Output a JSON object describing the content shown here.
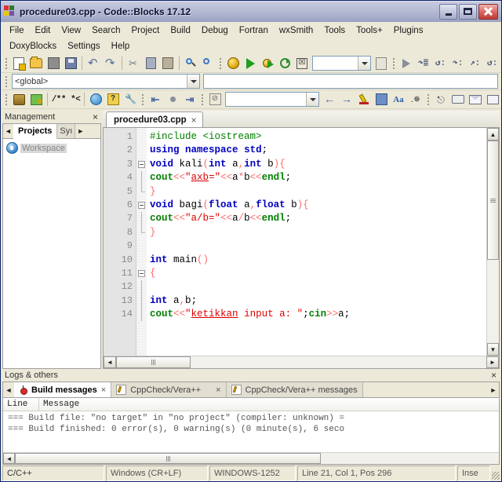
{
  "window": {
    "title": "procedure03.cpp - Code::Blocks 17.12",
    "logo_icon": "codeblocks-logo-icon",
    "minimize_label": "_",
    "maximize_label": "",
    "close_label": ""
  },
  "menubar": {
    "row1": [
      "File",
      "Edit",
      "View",
      "Search",
      "Project",
      "Build",
      "Debug",
      "Fortran",
      "wxSmith",
      "Tools",
      "Tools+",
      "Plugins"
    ],
    "row2": [
      "DoxyBlocks",
      "Settings",
      "Help"
    ]
  },
  "toolbar_main": {
    "groups": [
      [
        "new-file-icon",
        "open-file-icon",
        "save-icon",
        "save-all-icon"
      ],
      [
        "undo-icon",
        "redo-icon"
      ],
      [
        "cut-icon",
        "copy-icon",
        "paste-icon"
      ],
      [
        "find-icon",
        "replace-icon"
      ]
    ],
    "build_group": [
      "build-icon",
      "run-icon",
      "build-and-run-icon",
      "rebuild-icon",
      "abort-icon"
    ],
    "target_combo_value": "",
    "target_combo_placeholder": "",
    "select_target_icon": "select-target-icon",
    "debug_group": [
      "debug-continue-icon",
      "debug-next-line-icon",
      "debug-step-into-icon",
      "debug-step-out-icon",
      "debug-next-instruction-icon",
      "debug-step-into-instruction-icon"
    ]
  },
  "scope_bar": {
    "scope_value": "<global>",
    "function_value": ""
  },
  "toolbar_secondary": {
    "doxy_group": [
      "doxyblocks-extract-icon",
      "doxyblocks-wizard-icon"
    ],
    "comment_label": "/** *<",
    "html_group": [
      "doxyblocks-html-icon",
      "doxyblocks-help-icon",
      "doxyblocks-config-icon"
    ],
    "nav_group": [
      "jump-back-icon",
      "bookmark-dot-icon",
      "jump-forward-icon"
    ],
    "clear_icon": "clear-bookmarks-icon",
    "search_value": "",
    "arrow_group": [
      "nav-back-icon",
      "nav-forward-icon"
    ],
    "edit_group": [
      "highlight-icon",
      "bookmark-icon",
      "font-icon",
      "whitespace-icon"
    ],
    "wx_group": [
      "pointer-icon",
      "panel-icon",
      "envelope-icon",
      "dialog-icon"
    ]
  },
  "management": {
    "title": "Management",
    "close_label": "×",
    "tabs": [
      {
        "label": "Projects",
        "active": true
      },
      {
        "label": "Syı",
        "active": false
      }
    ],
    "prev_arrow": "◄",
    "next_arrow": "►",
    "tree": [
      {
        "icon": "workspace-icon",
        "label": "Workspace"
      }
    ]
  },
  "editor": {
    "tab_label": "procedure03.cpp",
    "tab_close": "×",
    "lines": [
      {
        "n": 1,
        "fold": "none",
        "tokens": [
          {
            "t": "#include <iostream>",
            "c": "pp"
          }
        ]
      },
      {
        "n": 2,
        "fold": "none",
        "tokens": [
          {
            "t": "using",
            "c": "k"
          },
          {
            "t": " ",
            "c": "idf"
          },
          {
            "t": "namespace",
            "c": "k"
          },
          {
            "t": " ",
            "c": "idf"
          },
          {
            "t": "std",
            "c": "k"
          },
          {
            "t": ";",
            "c": "idf"
          }
        ]
      },
      {
        "n": 3,
        "fold": "start",
        "tokens": [
          {
            "t": "void",
            "c": "ty"
          },
          {
            "t": " kali",
            "c": "idf"
          },
          {
            "t": "(",
            "c": "op"
          },
          {
            "t": "int",
            "c": "ty"
          },
          {
            "t": " a",
            "c": "idf"
          },
          {
            "t": ",",
            "c": "op"
          },
          {
            "t": "int",
            "c": "ty"
          },
          {
            "t": " b",
            "c": "idf"
          },
          {
            "t": ")",
            "c": "op"
          },
          {
            "t": "{",
            "c": "op"
          }
        ]
      },
      {
        "n": 4,
        "fold": "line",
        "tokens": [
          {
            "t": "cout",
            "c": "cio"
          },
          {
            "t": "<<",
            "c": "op"
          },
          {
            "t": "\"",
            "c": "str"
          },
          {
            "t": "axb",
            "c": "str u"
          },
          {
            "t": "=\"",
            "c": "str"
          },
          {
            "t": "<<",
            "c": "op"
          },
          {
            "t": "a",
            "c": "idf"
          },
          {
            "t": "*",
            "c": "op"
          },
          {
            "t": "b",
            "c": "idf"
          },
          {
            "t": "<<",
            "c": "op"
          },
          {
            "t": "endl",
            "c": "cio"
          },
          {
            "t": ";",
            "c": "idf"
          }
        ]
      },
      {
        "n": 5,
        "fold": "end",
        "tokens": [
          {
            "t": "}",
            "c": "op"
          }
        ]
      },
      {
        "n": 6,
        "fold": "start",
        "tokens": [
          {
            "t": "void",
            "c": "ty"
          },
          {
            "t": " bagi",
            "c": "idf"
          },
          {
            "t": "(",
            "c": "op"
          },
          {
            "t": "float",
            "c": "ty"
          },
          {
            "t": " a",
            "c": "idf"
          },
          {
            "t": ",",
            "c": "op"
          },
          {
            "t": "float",
            "c": "ty"
          },
          {
            "t": " b",
            "c": "idf"
          },
          {
            "t": ")",
            "c": "op"
          },
          {
            "t": "{",
            "c": "op"
          }
        ]
      },
      {
        "n": 7,
        "fold": "line",
        "tokens": [
          {
            "t": "cout",
            "c": "cio"
          },
          {
            "t": "<<",
            "c": "op"
          },
          {
            "t": "\"a/b=\"",
            "c": "str"
          },
          {
            "t": "<<",
            "c": "op"
          },
          {
            "t": "a",
            "c": "idf"
          },
          {
            "t": "/",
            "c": "op"
          },
          {
            "t": "b",
            "c": "idf"
          },
          {
            "t": "<<",
            "c": "op"
          },
          {
            "t": "endl",
            "c": "cio"
          },
          {
            "t": ";",
            "c": "idf"
          }
        ]
      },
      {
        "n": 8,
        "fold": "end",
        "tokens": [
          {
            "t": "}",
            "c": "op"
          }
        ]
      },
      {
        "n": 9,
        "fold": "none",
        "tokens": [
          {
            "t": "",
            "c": "idf"
          }
        ]
      },
      {
        "n": 10,
        "fold": "none",
        "tokens": [
          {
            "t": "int",
            "c": "ty"
          },
          {
            "t": " main",
            "c": "idf"
          },
          {
            "t": "()",
            "c": "op"
          }
        ]
      },
      {
        "n": 11,
        "fold": "start",
        "tokens": [
          {
            "t": "{",
            "c": "op"
          }
        ]
      },
      {
        "n": 12,
        "fold": "line",
        "tokens": [
          {
            "t": "",
            "c": "idf"
          }
        ]
      },
      {
        "n": 13,
        "fold": "line",
        "tokens": [
          {
            "t": "int",
            "c": "ty"
          },
          {
            "t": " a",
            "c": "idf"
          },
          {
            "t": ",",
            "c": "op"
          },
          {
            "t": "b",
            "c": "idf"
          },
          {
            "t": ";",
            "c": "idf"
          }
        ]
      },
      {
        "n": 14,
        "fold": "line",
        "tokens": [
          {
            "t": "cout",
            "c": "cio"
          },
          {
            "t": "<<",
            "c": "op"
          },
          {
            "t": "\"",
            "c": "str"
          },
          {
            "t": "ketikkan",
            "c": "str u"
          },
          {
            "t": " input a: \"",
            "c": "str"
          },
          {
            "t": ";",
            "c": "idf"
          },
          {
            "t": "cin",
            "c": "cio"
          },
          {
            "t": ">>",
            "c": "op"
          },
          {
            "t": "a",
            "c": "idf"
          },
          {
            "t": ";",
            "c": "idf"
          }
        ]
      }
    ],
    "vscroll": {
      "up": "▲",
      "down": "▼"
    },
    "hscroll": {
      "left": "◄",
      "right": "►"
    }
  },
  "logs": {
    "title": "Logs & others",
    "close_label": "×",
    "prev_arrow": "◄",
    "next_arrow": "►",
    "tabs": [
      {
        "label": "Build messages",
        "icon": "build-messages-icon",
        "close": "×",
        "active": true
      },
      {
        "label": "CppCheck/Vera++",
        "icon": "cppcheck-icon",
        "close": "×",
        "active": false
      },
      {
        "label": "CppCheck/Vera++ messages",
        "icon": "cppcheck-messages-icon",
        "close": "",
        "active": false
      }
    ],
    "columns": [
      "Line",
      "Message"
    ],
    "rows": [
      "=== Build file: \"no target\" in \"no project\" (compiler: unknown) =",
      "=== Build finished: 0 error(s), 0 warning(s) (0 minute(s), 6 seco"
    ],
    "hscroll": {
      "left": "◄",
      "right": "►"
    }
  },
  "statusbar": {
    "cells": [
      "C/C++",
      "Windows (CR+LF)",
      "WINDOWS-1252",
      "Line 21, Col 1, Pos 296",
      "Inse"
    ]
  }
}
